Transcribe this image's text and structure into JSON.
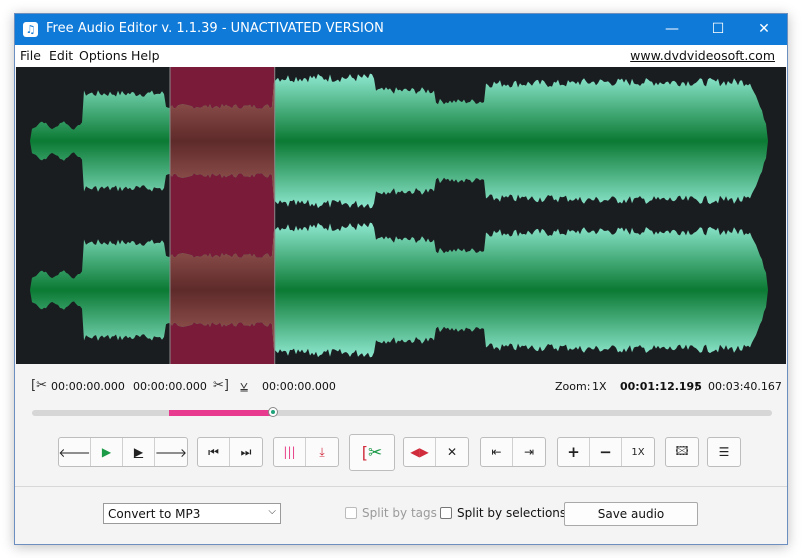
{
  "window": {
    "title": "Free Audio Editor v. 1.1.39 - UNACTIVATED VERSION",
    "controls": {
      "minimize": "—",
      "maximize": "☐",
      "close": "✕"
    }
  },
  "menu": {
    "items": [
      "File",
      "Edit",
      "Options",
      "Help"
    ],
    "site_link": "www.dvdvideosoft.com"
  },
  "waveform": {
    "selection": {
      "start_fraction": 0.2,
      "end_fraction": 0.336
    },
    "colors": {
      "background": "#1a1d20",
      "wave_light": "#7fe0c5",
      "wave_dark": "#0c7a34",
      "selection": "#7a1b3a"
    }
  },
  "times": {
    "selection_start": "00:00:00.000",
    "selection_length": "00:00:00.000",
    "selection_end": "00:00:00.000",
    "zoom_label": "Zoom:",
    "zoom_value": "1X",
    "current_position": "00:01:12.195",
    "separator": "/",
    "total_duration": "00:03:40.167"
  },
  "progress": {
    "selection_start_fraction": 0.185,
    "selection_end_fraction": 0.326,
    "playhead_fraction": 0.326,
    "selection_color": "#e83a8e"
  },
  "toolbar": {
    "zoom_value": "1X"
  },
  "bottom": {
    "convert_format": "Convert to MP3",
    "split_by_tags": "Split by tags",
    "split_by_selections": "Split by selections",
    "save_audio": "Save audio"
  }
}
